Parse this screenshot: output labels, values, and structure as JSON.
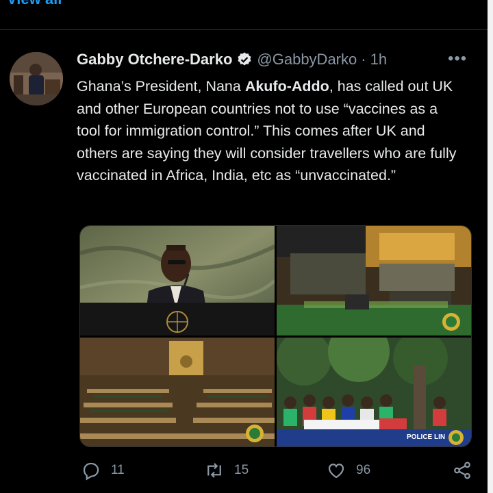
{
  "top": {
    "view_all": "View all"
  },
  "tweet": {
    "display_name": "Gabby Otchere-Darko",
    "handle": "@GabbyDarko",
    "separator": "·",
    "time": "1h",
    "more": "•••",
    "text_part1": "Ghana’s President, Nana ",
    "text_bold": "Akufo-Addo",
    "text_part2": ", has called out UK and other European countries not to use “vaccines as a tool for immigration control.” This comes after UK and others are saying they will consider travellers who are fully vaccinated in Africa, India, etc as “unvaccinated.”"
  },
  "media": {
    "caption_bottom_right": "POLICE LIN"
  },
  "actions": {
    "reply_count": "11",
    "retweet_count": "15",
    "like_count": "96"
  },
  "icons": [
    "reply-icon",
    "retweet-icon",
    "like-icon",
    "share-icon",
    "verified-badge-icon",
    "more-icon"
  ],
  "colors": {
    "accent": "#1d9bf0",
    "text": "#e7e9ea",
    "muted": "#8b98a5",
    "background": "#000000"
  }
}
